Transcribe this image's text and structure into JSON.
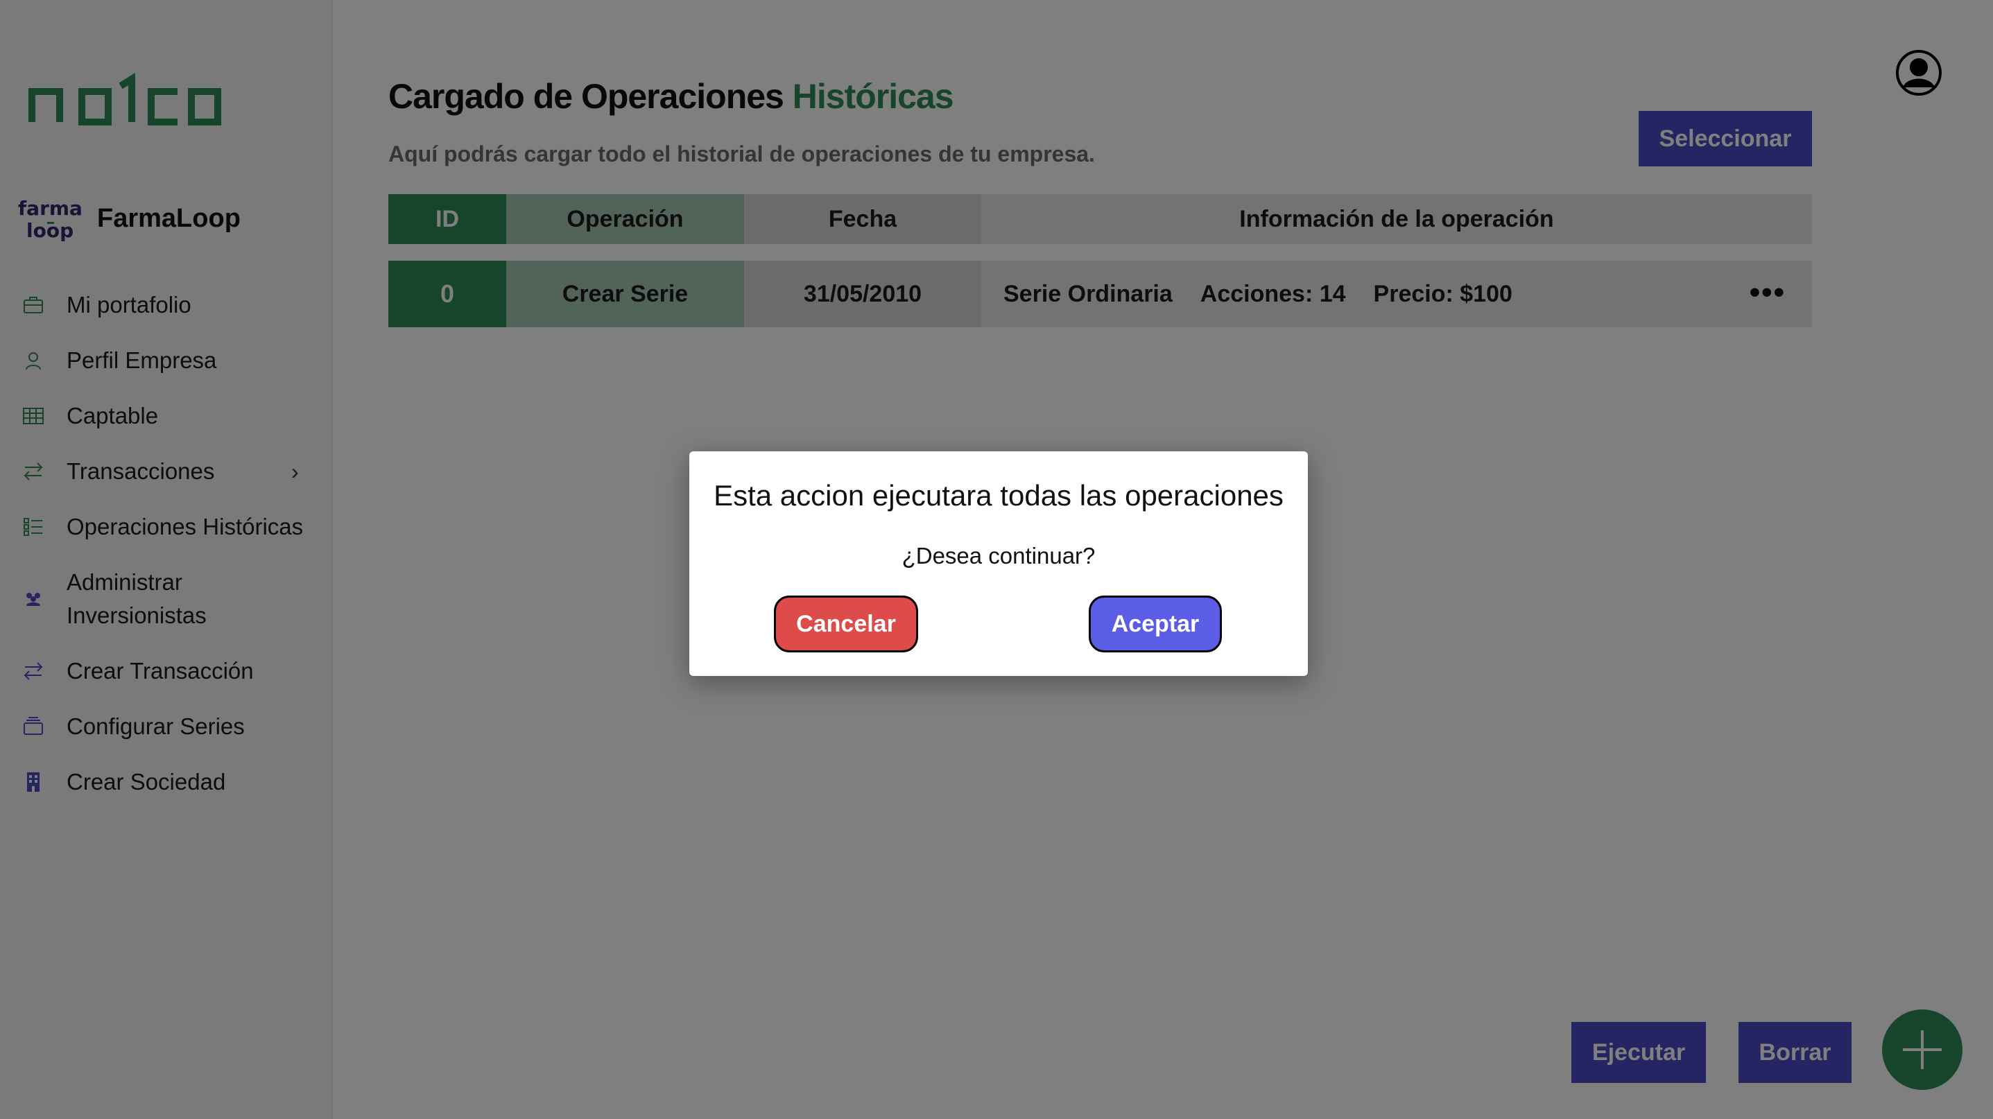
{
  "brand": {
    "logo_text": "nalca"
  },
  "company": {
    "logo_text": "farma loop",
    "name": "FarmaLoop"
  },
  "sidebar": {
    "items": [
      {
        "label": "Mi portafolio",
        "icon": "briefcase-icon"
      },
      {
        "label": "Perfil Empresa",
        "icon": "user-icon"
      },
      {
        "label": "Captable",
        "icon": "table-icon"
      },
      {
        "label": "Transacciones",
        "icon": "arrows-icon",
        "has_submenu": true
      },
      {
        "label": "Operaciones Históricas",
        "icon": "checklist-icon"
      },
      {
        "label": "Administrar Inversionistas",
        "label_line1": "Administrar",
        "label_line2": "Inversionistas",
        "icon": "users-icon"
      },
      {
        "label": "Crear Transacción",
        "icon": "arrows-icon"
      },
      {
        "label": "Configurar Series",
        "icon": "layers-icon"
      },
      {
        "label": "Crear Sociedad",
        "icon": "building-icon"
      }
    ]
  },
  "header": {
    "title_part1": "Cargado de Operaciones",
    "title_part2": "Históricas",
    "subtitle": "Aquí podrás cargar todo el historial de operaciones de tu empresa.",
    "select_button": "Seleccionar"
  },
  "table": {
    "columns": [
      "ID",
      "Operación",
      "Fecha",
      "Información de la operación"
    ],
    "rows": [
      {
        "id": "0",
        "operation": "Crear Serie",
        "date": "31/05/2010",
        "info": [
          "Serie Ordinaria",
          "Acciones: 14",
          "Precio: $100"
        ],
        "more": "•••"
      }
    ]
  },
  "footer": {
    "run_button": "Ejecutar",
    "delete_button": "Borrar"
  },
  "modal": {
    "title": "Esta accion ejecutara todas las operaciones",
    "text": "¿Desea continuar?",
    "cancel": "Cancelar",
    "accept": "Aceptar"
  },
  "colors": {
    "accent_green": "#2e8a57",
    "primary_blue": "#4b4bc8",
    "cancel_red": "#dd4b4b",
    "accept_blue": "#5b5de6"
  }
}
